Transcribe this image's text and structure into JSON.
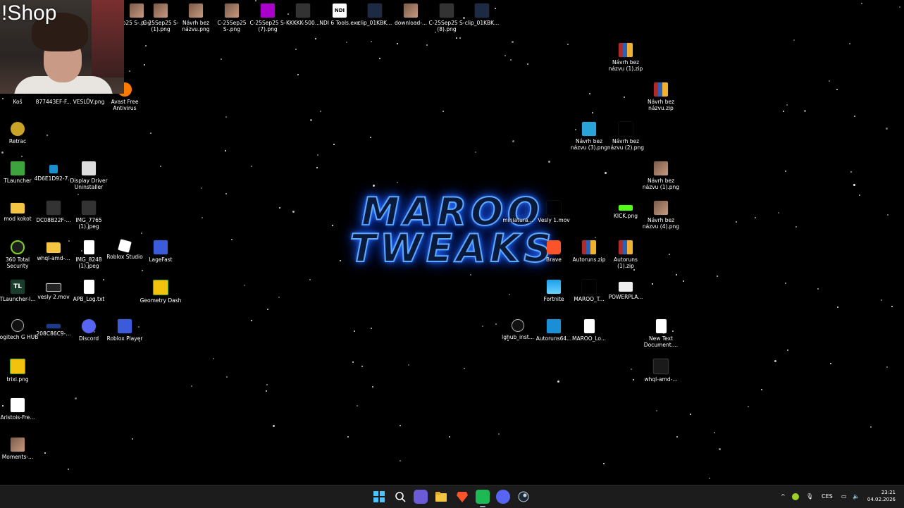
{
  "overlay": {
    "shop_text": "!Shop"
  },
  "logo": {
    "line1": "MAROO",
    "line2": "TWEAKS"
  },
  "icons": {
    "top1": "p25 S-.png",
    "top2": "C-25Sep25 S-(1).png",
    "top3": "Návrh bez názvu.png",
    "top4": "C-25Sep25 S-.png",
    "top5": "C-25Sep25 S-(7).png",
    "top6": "KKKKK-500...",
    "top7": "NDI 6 Tools.exe",
    "top8": "clip_01KBK...",
    "top9": "download-...",
    "top10": "C-25Sep25 S-(8).png",
    "top11": "clip_01KBK...",
    "kos": "Koš",
    "hex877": "877443EF-F...",
    "veslov": "VESLŮV.png",
    "avast": "Avast Free Antivirus",
    "retrac": "Retrac",
    "tlauncher": "TLauncher",
    "hex4d6": "4D6E1D92-7...",
    "ddu": "Display Driver Uninstaller",
    "modkokot": "mod kokot",
    "dc08": "DC08B22F-...",
    "img7765": "IMG_7765 (1).jpeg",
    "sec360": "360 Total Security",
    "whql1": "whql-amd-...",
    "img8248": "IMG_8248 (1).jpeg",
    "robloxstudio": "Roblox Studio",
    "lagefast": "LageFast",
    "tlauncher2": "TLauncher-I...",
    "vesly2": "vesly 2.mov",
    "apb": "APB_Log.txt",
    "gdash": "Geometry Dash",
    "logitech": "Logitech G HUB",
    "hex208": "208C86C9-...",
    "discord": "Discord",
    "robloxplayer": "Roblox Player",
    "trixi": "trixi.png",
    "aristois": "Aristois-Fre...",
    "moments": "Moments-...",
    "zip1": "Návrh bez názvu (1).zip",
    "zip2": "Návrh bez názvu.zip",
    "png3": "Návrh bez názvu (3).png",
    "png2": "Návrh bez názvu (2).png",
    "png1": "Návrh bez názvu (1).png",
    "miniatura": "miniatura...",
    "vesly1": "Vesly 1.mov",
    "kick": "KICK.png",
    "png4": "Návrh bez názvu (4).png",
    "brave": "Brave",
    "autorunszip": "Autoruns.zip",
    "autoruns1": "Autoruns (1).zip",
    "fortnite": "Fortnite",
    "marooT": "MAROO_T...",
    "powerpla": "POWERPLA...",
    "lghub": "lghub_inst...",
    "autoruns64": "Autoruns64...",
    "marooLo": "MAROO_Lo...",
    "newtext": "New Text Document....",
    "whql2": "whql-amd-..."
  },
  "tray": {
    "lang": "CES",
    "time": "23:21",
    "date": "04.02.2026"
  }
}
